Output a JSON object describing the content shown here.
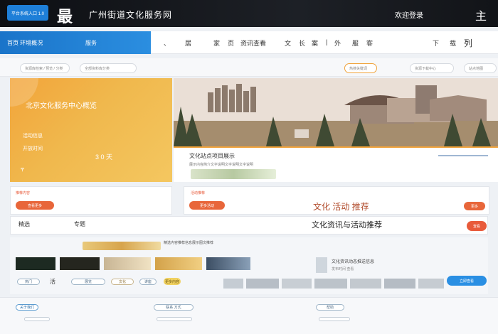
{
  "topbar": {
    "brand_button": "平台系统入口 1.0",
    "brand_glyph": "最",
    "site_title": "广州街道文化服务网",
    "right_text": "欢迎登录",
    "right_glyph": "主"
  },
  "nav": {
    "blue_left": "首页 环境概况",
    "blue_right": "服务",
    "items": [
      "、",
      "居",
      "家",
      "页",
      "资讯查看",
      "文",
      "长",
      "案",
      "|",
      "外",
      "服",
      "客",
      "下",
      "载",
      "列"
    ]
  },
  "search": {
    "box1": "资源库检索 / 预览 / 分类",
    "box2": "全部资料库分类",
    "box3": "热搜关键词",
    "box4": "资源下载中心",
    "box5": "站点地图"
  },
  "hero": {
    "left_title": "北京文化服务中心概览",
    "left_line1": "活动信息",
    "left_line2": "开放时间",
    "left_code": "3 0 天",
    "left_side": "〒",
    "card_title": "文化站点项目展示",
    "card_text": "展示内容简介文字说明文字说明文字说明"
  },
  "row1": {
    "left_label": "推荐内容",
    "left_btn": "查看更多",
    "mid_label": "活动推荐",
    "mid_btn": "更多活动",
    "right_title": "文化 活动 推荐",
    "right_btn": "更多"
  },
  "row2": {
    "left_a": "精选",
    "left_b": "专题",
    "right_title": "文化资讯与活动推荐",
    "right_btn": "查看"
  },
  "row3": {
    "caption": "精选内容推荐信息展示图文推荐",
    "side_text": "文化资讯动态推送信息",
    "side_sub": "发布时间 查看",
    "blue_btn": "立即查看"
  },
  "row4": {
    "a1": "热门",
    "a2": "活",
    "b1": "展览",
    "b2": "文化",
    "b3": "讲座",
    "c1": "更多内容"
  },
  "footer": {
    "col1": "关于我们",
    "col2": "联系 方式",
    "col3": "帮助"
  },
  "colors": {
    "accent_blue": "#1e7fd8",
    "accent_orange": "#f0a33b",
    "pill_red": "#e85a3a"
  }
}
